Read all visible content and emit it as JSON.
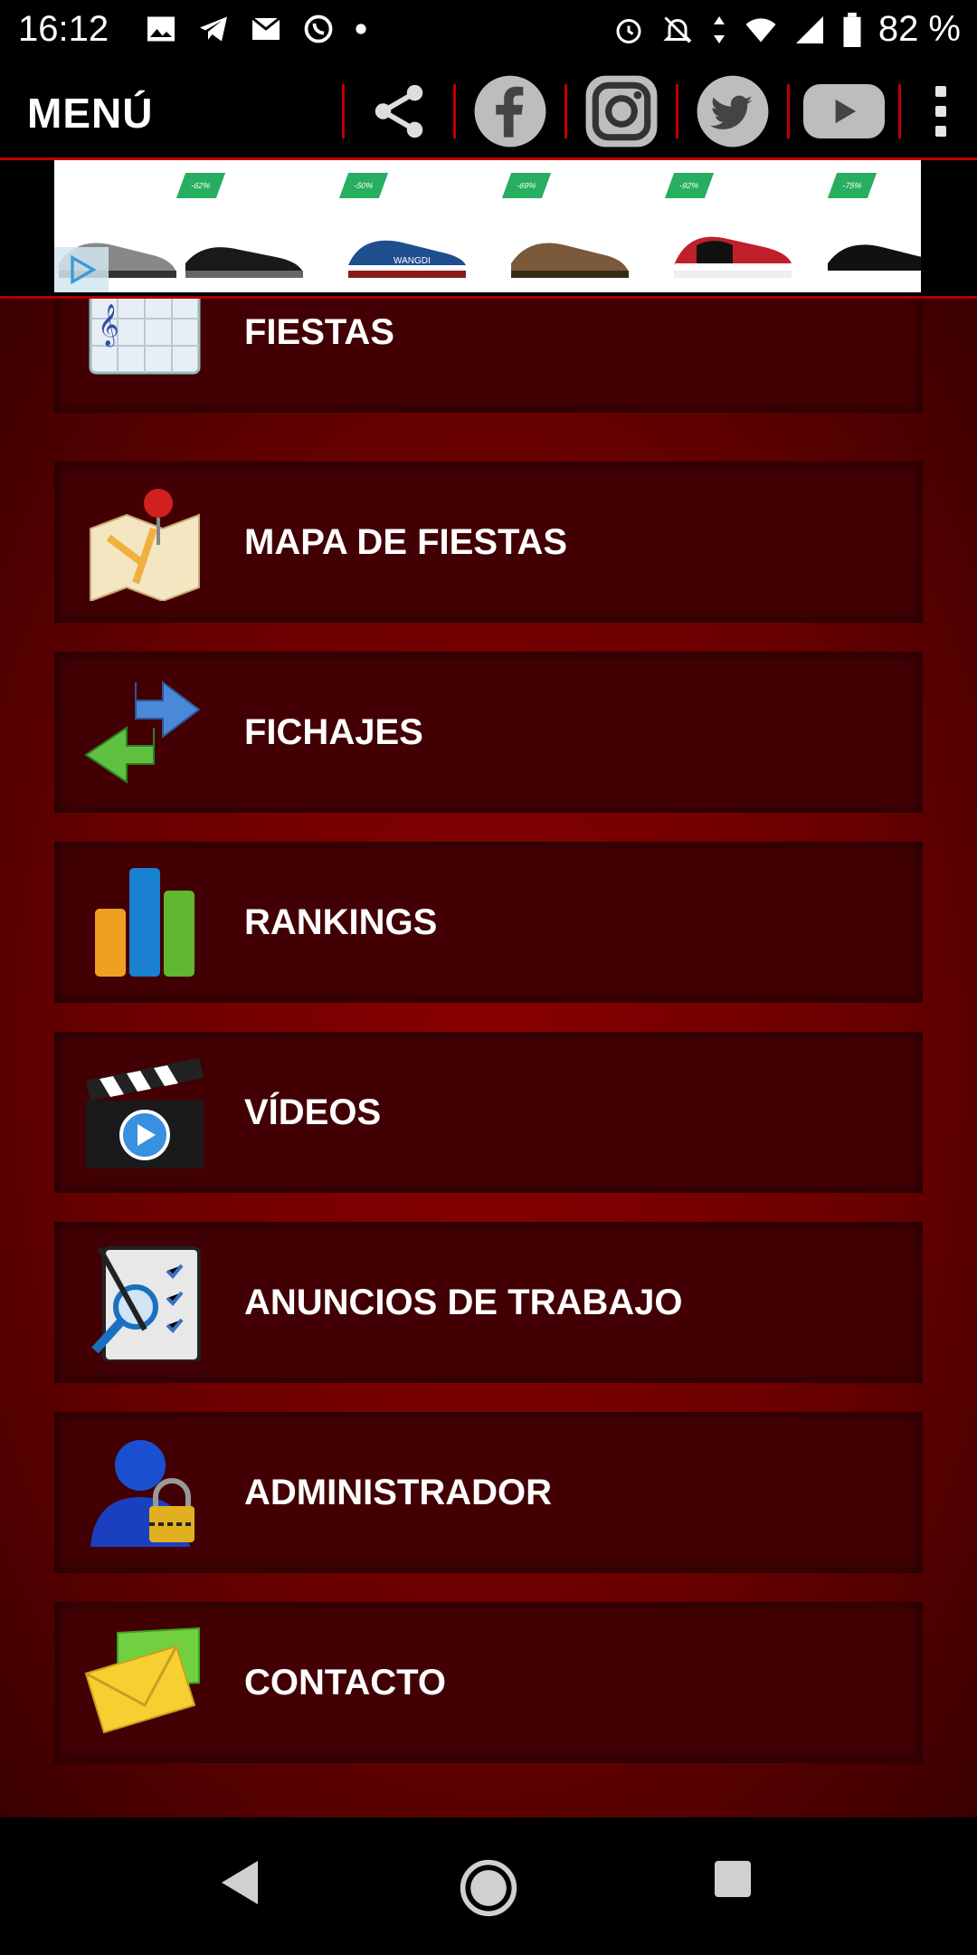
{
  "status_bar": {
    "time": "16:12",
    "battery": "82 %",
    "icons": [
      "gallery-icon",
      "telegram-icon",
      "gmail-icon",
      "whatsapp-icon",
      "dot-icon",
      "alarm-icon",
      "notifications-off-icon",
      "data-arrows-icon",
      "wifi-icon",
      "signal-icon",
      "battery-icon"
    ]
  },
  "header": {
    "title": "MENÚ",
    "actions": [
      "share-icon",
      "facebook-icon",
      "instagram-icon",
      "twitter-icon",
      "youtube-icon",
      "more-vert-icon"
    ]
  },
  "ad_banner": {
    "discounts": [
      "-62%",
      "-50%",
      "-69%",
      "-92%",
      "-75%"
    ],
    "brand_text": "WANGDI"
  },
  "menu": {
    "items": [
      {
        "label": "FIESTAS",
        "icon": "calendar-music-icon"
      },
      {
        "label": "MAPA DE FIESTAS",
        "icon": "map-pin-icon"
      },
      {
        "label": "FICHAJES",
        "icon": "transfer-arrows-icon"
      },
      {
        "label": "RANKINGS",
        "icon": "bar-chart-icon"
      },
      {
        "label": "VÍDEOS",
        "icon": "clapperboard-icon"
      },
      {
        "label": "ANUNCIOS DE TRABAJO",
        "icon": "job-search-icon"
      },
      {
        "label": "ADMINISTRADOR",
        "icon": "admin-lock-icon"
      },
      {
        "label": "CONTACTO",
        "icon": "envelope-icon"
      }
    ]
  },
  "nav_bar": {
    "buttons": [
      "back-icon",
      "home-icon",
      "recents-icon"
    ]
  },
  "colors": {
    "accent": "#c00000",
    "card_bg": "#420004",
    "background": "#7a0000"
  }
}
